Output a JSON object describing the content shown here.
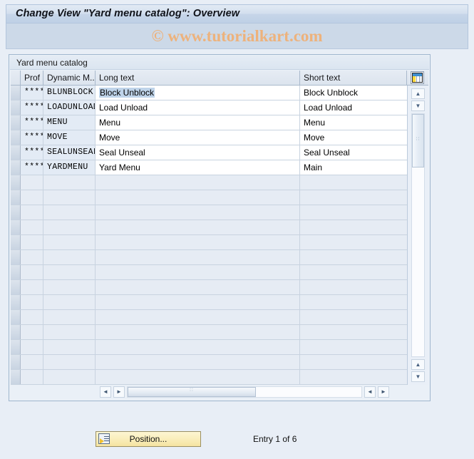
{
  "window": {
    "title": "Change View \"Yard menu catalog\": Overview"
  },
  "watermark": {
    "text": "© www.tutorialkart.com",
    "color": "#edb27c"
  },
  "panel": {
    "title": "Yard menu catalog"
  },
  "toolbar_icons": {
    "column_config": "table-columns-icon"
  },
  "table": {
    "columns": [
      {
        "key": "select",
        "label": ""
      },
      {
        "key": "prof",
        "label": "Prof"
      },
      {
        "key": "dynamic",
        "label": "Dynamic M..."
      },
      {
        "key": "long_text",
        "label": "Long text"
      },
      {
        "key": "short_text",
        "label": "Short text"
      }
    ],
    "rows": [
      {
        "prof": "****",
        "dynamic": "BLUNBLOCK",
        "long_text": "Block Unblock",
        "short_text": "Block Unblock",
        "selected_cell": "long_text"
      },
      {
        "prof": "****",
        "dynamic": "LOADUNLOAD",
        "long_text": "Load Unload",
        "short_text": "Load Unload"
      },
      {
        "prof": "****",
        "dynamic": "MENU",
        "long_text": "Menu",
        "short_text": "Menu"
      },
      {
        "prof": "****",
        "dynamic": "MOVE",
        "long_text": "Move",
        "short_text": "Move"
      },
      {
        "prof": "****",
        "dynamic": "SEALUNSEAL",
        "long_text": "Seal Unseal",
        "short_text": "Seal Unseal"
      },
      {
        "prof": "****",
        "dynamic": "YARDMENU",
        "long_text": "Yard Menu",
        "short_text": "Main"
      }
    ],
    "empty_row_count": 14
  },
  "scrollbars": {
    "vertical": {
      "up_glyph": "▲",
      "down_glyph": "▼",
      "bottom_up_glyph": "▲",
      "bottom_down_glyph": "▼",
      "grip": "∷"
    },
    "horizontal": {
      "left_glyph": "◄",
      "right_glyph": "►",
      "end_left_glyph": "◄",
      "end_right_glyph": "►",
      "grip": "∷"
    }
  },
  "footer": {
    "position_button_label": "Position...",
    "entry_status": "Entry 1 of 6"
  },
  "colors": {
    "window_background": "#e8eef6",
    "title_bar": "#cddcec",
    "panel_border": "#9fb6ce",
    "row_alt": "#e3ebf5",
    "selection": "#bfd4ea",
    "button_yellow": "#f9edb8"
  }
}
